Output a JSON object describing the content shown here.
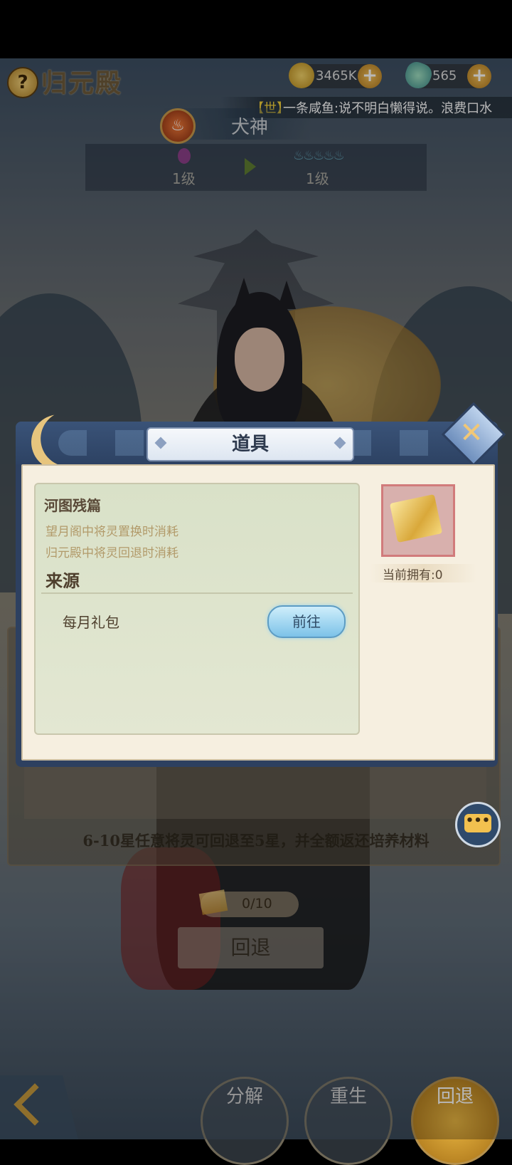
{
  "header": {
    "help_icon": "?",
    "title": "归元殿",
    "coins": "3465K",
    "gems": "565"
  },
  "chat": {
    "channel_tag": "【世】",
    "message": "一条咸鱼:说不明白懒得说。浪费口水"
  },
  "hero": {
    "element_icon": "fire-icon",
    "name": "犬神",
    "level_from": "1级",
    "level_to": "1级",
    "stars_to": "♨♨♨♨♨"
  },
  "retreat_panel": {
    "rule_text": "6-10星任意将灵可回退至5星，并全额返还培养材料",
    "cost_text": "0/10",
    "retreat_button": "回退"
  },
  "bottom_nav": {
    "decompose": "分解",
    "rebirth": "重生",
    "retreat": "回退"
  },
  "dialog": {
    "title": "道具",
    "item_name": "河图残篇",
    "desc_line1": "望月阁中将灵置换时消耗",
    "desc_line2": "归元殿中将灵回退时消耗",
    "source_heading": "来源",
    "source_name": "每月礼包",
    "go_button": "前往",
    "owned_text": "当前拥有:0",
    "close_icon": "✕"
  },
  "chat_button": {
    "icon": "•••"
  }
}
